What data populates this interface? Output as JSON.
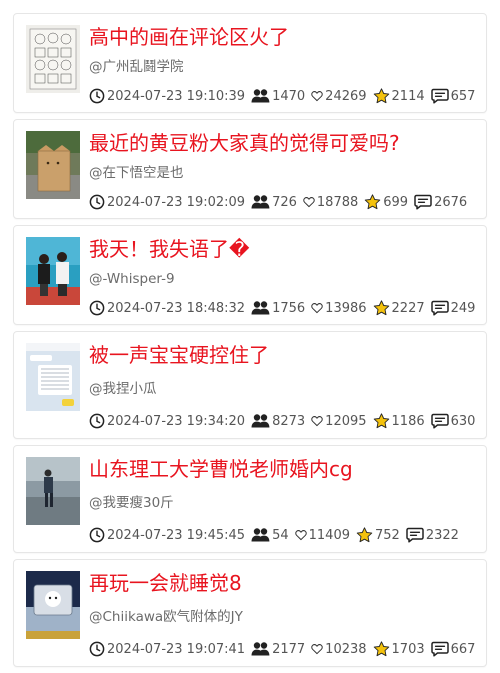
{
  "colors": {
    "title": "#e8141f",
    "meta_text": "#555555",
    "author": "#6b6b6b",
    "star": "#f4c20d"
  },
  "icons": {
    "time": "clock-icon",
    "viewers": "people-icon",
    "likes": "heart-icon",
    "favorites": "star-icon",
    "comments": "comment-icon"
  },
  "posts": [
    {
      "title": "高中的画在评论区火了",
      "author": "@广州乱鬪学院",
      "time": "2024-07-23 19:10:39",
      "viewers": "1470",
      "likes": "24269",
      "favorites": "2114",
      "comments": "657"
    },
    {
      "title": "最近的黄豆粉大家真的觉得可爱吗?",
      "author": "@在下悟空是也",
      "time": "2024-07-23 19:02:09",
      "viewers": "726",
      "likes": "18788",
      "favorites": "699",
      "comments": "2676"
    },
    {
      "title": "我天！我失语了�",
      "author": "@-Whisper-9",
      "time": "2024-07-23 18:48:32",
      "viewers": "1756",
      "likes": "13986",
      "favorites": "2227",
      "comments": "249"
    },
    {
      "title": "被一声宝宝硬控住了",
      "author": "@我捏小瓜",
      "time": "2024-07-23 19:34:20",
      "viewers": "8273",
      "likes": "12095",
      "favorites": "1186",
      "comments": "630"
    },
    {
      "title": "山东理工大学曹悦老师婚内cg",
      "author": "@我要瘦30斤",
      "time": "2024-07-23 19:45:45",
      "viewers": "54",
      "likes": "11409",
      "favorites": "752",
      "comments": "2322"
    },
    {
      "title": "再玩一会就睡觉8",
      "author": "@Chiikawa欧气附体的JY",
      "time": "2024-07-23 19:07:41",
      "viewers": "2177",
      "likes": "10238",
      "favorites": "1703",
      "comments": "667"
    }
  ]
}
